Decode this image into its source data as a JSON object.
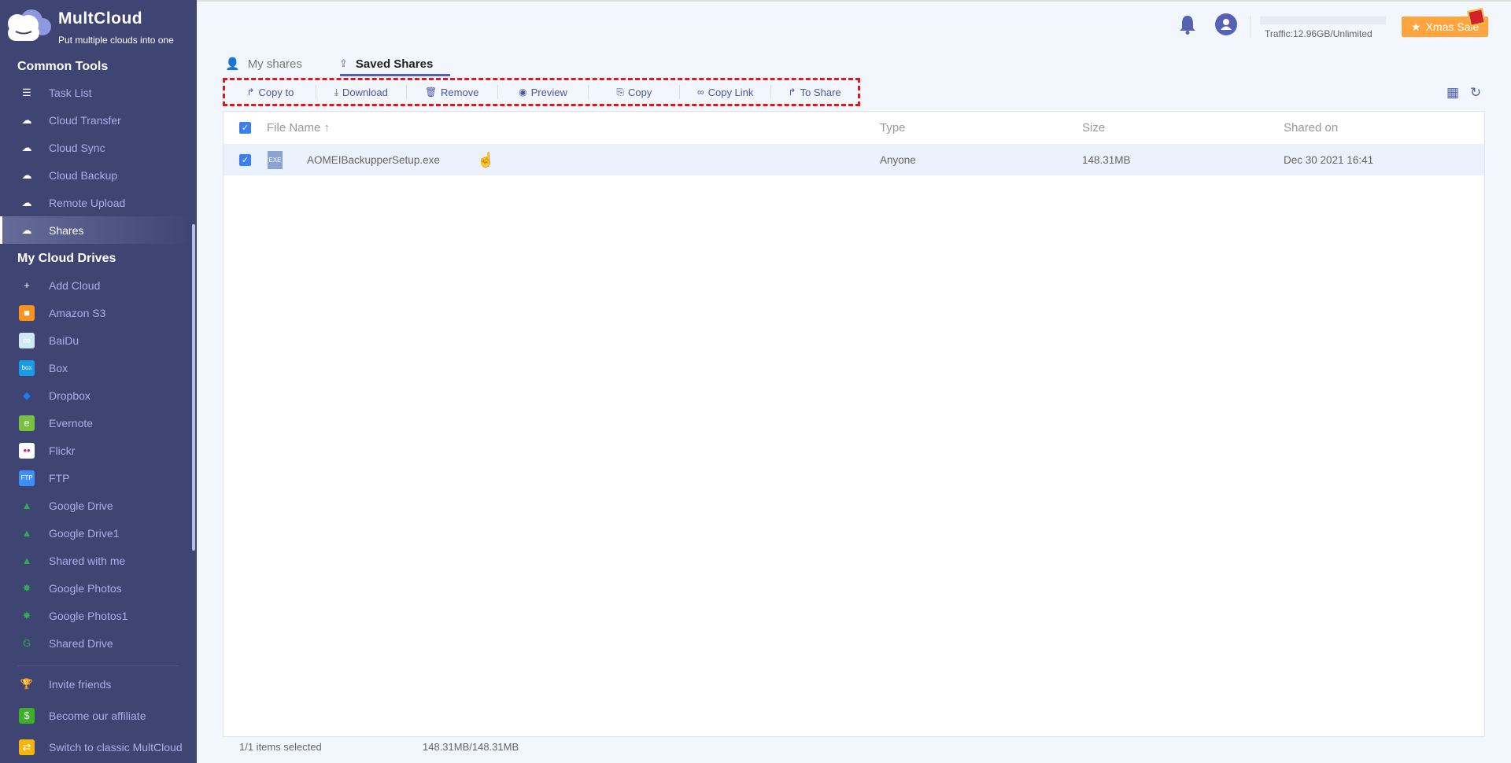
{
  "brand": {
    "name": "MultCloud",
    "tagline": "Put multiple clouds into one"
  },
  "sidebar": {
    "common_tools_title": "Common Tools",
    "common_tools": [
      {
        "label": "Task List",
        "icon": "clipboard-icon",
        "glyph": "☰",
        "color": "transparent"
      },
      {
        "label": "Cloud Transfer",
        "icon": "cloud-transfer-icon",
        "glyph": "☁",
        "color": "transparent"
      },
      {
        "label": "Cloud Sync",
        "icon": "cloud-sync-icon",
        "glyph": "☁",
        "color": "transparent"
      },
      {
        "label": "Cloud Backup",
        "icon": "cloud-backup-icon",
        "glyph": "☁",
        "color": "transparent"
      },
      {
        "label": "Remote Upload",
        "icon": "cloud-upload-icon",
        "glyph": "☁",
        "color": "transparent"
      },
      {
        "label": "Shares",
        "icon": "cloud-share-icon",
        "glyph": "☁",
        "color": "transparent",
        "active": true
      }
    ],
    "drives_title": "My Cloud Drives",
    "drives": [
      {
        "label": "Add Cloud",
        "icon": "add-cloud-icon",
        "glyph": "+",
        "color": "transparent"
      },
      {
        "label": "Amazon S3",
        "icon": "amazon-s3-icon",
        "glyph": "■",
        "color": "#f7931e"
      },
      {
        "label": "BaiDu",
        "icon": "baidu-icon",
        "glyph": "∞",
        "color": "#cfe8f5"
      },
      {
        "label": "Box",
        "icon": "box-icon",
        "glyph": "box",
        "color": "#1a9be6"
      },
      {
        "label": "Dropbox",
        "icon": "dropbox-icon",
        "glyph": "◆",
        "color": "transparent"
      },
      {
        "label": "Evernote",
        "icon": "evernote-icon",
        "glyph": "e",
        "color": "#7ac142"
      },
      {
        "label": "Flickr",
        "icon": "flickr-icon",
        "glyph": "••",
        "color": "#ffffff"
      },
      {
        "label": "FTP",
        "icon": "ftp-icon",
        "glyph": "FTP",
        "color": "#3e8ef7"
      },
      {
        "label": "Google Drive",
        "icon": "google-drive-icon",
        "glyph": "▲",
        "color": "transparent"
      },
      {
        "label": "Google Drive1",
        "icon": "google-drive-icon",
        "glyph": "▲",
        "color": "transparent"
      },
      {
        "label": "Shared with me",
        "icon": "google-drive-icon",
        "glyph": "▲",
        "color": "transparent"
      },
      {
        "label": "Google Photos",
        "icon": "google-photos-icon",
        "glyph": "✸",
        "color": "transparent"
      },
      {
        "label": "Google Photos1",
        "icon": "google-photos-icon",
        "glyph": "✸",
        "color": "transparent"
      },
      {
        "label": "Shared Drive",
        "icon": "google-g-icon",
        "glyph": "G",
        "color": "transparent"
      }
    ],
    "bottom": [
      {
        "label": "Invite friends",
        "icon": "trophy-icon",
        "glyph": "🏆",
        "color": "transparent"
      },
      {
        "label": "Become our affiliate",
        "icon": "dollar-icon",
        "glyph": "$",
        "color": "#3fae29"
      },
      {
        "label": "Switch to classic MultCloud",
        "icon": "switch-icon",
        "glyph": "⇄",
        "color": "#f5b50a"
      }
    ]
  },
  "header": {
    "traffic": "Traffic:12.96GB/Unlimited",
    "xmas_label": "Xmas Sale"
  },
  "tabs": {
    "my_shares": "My shares",
    "saved_shares": "Saved Shares"
  },
  "toolbar": [
    {
      "label": "Copy to",
      "icon": "copy-to-icon",
      "glyph": "↱"
    },
    {
      "label": "Download",
      "icon": "download-icon",
      "glyph": "⤓"
    },
    {
      "label": "Remove",
      "icon": "trash-icon",
      "glyph": "🗑"
    },
    {
      "label": "Preview",
      "icon": "eye-icon",
      "glyph": "◉"
    },
    {
      "label": "Copy",
      "icon": "copy-icon",
      "glyph": "⎘"
    },
    {
      "label": "Copy Link",
      "icon": "link-icon",
      "glyph": "∞"
    },
    {
      "label": "To Share",
      "icon": "share-icon",
      "glyph": "↱"
    }
  ],
  "table": {
    "columns": {
      "name": "File Name",
      "sort": "↑",
      "type": "Type",
      "size": "Size",
      "shared_on": "Shared on"
    },
    "rows": [
      {
        "name": "AOMEIBackupperSetup.exe",
        "file_icon_label": "EXE",
        "type": "Anyone",
        "size": "148.31MB",
        "shared_on": "Dec 30 2021 16:41",
        "checked": true
      }
    ]
  },
  "footer": {
    "selected": "1/1 items selected",
    "size": "148.31MB/148.31MB"
  }
}
